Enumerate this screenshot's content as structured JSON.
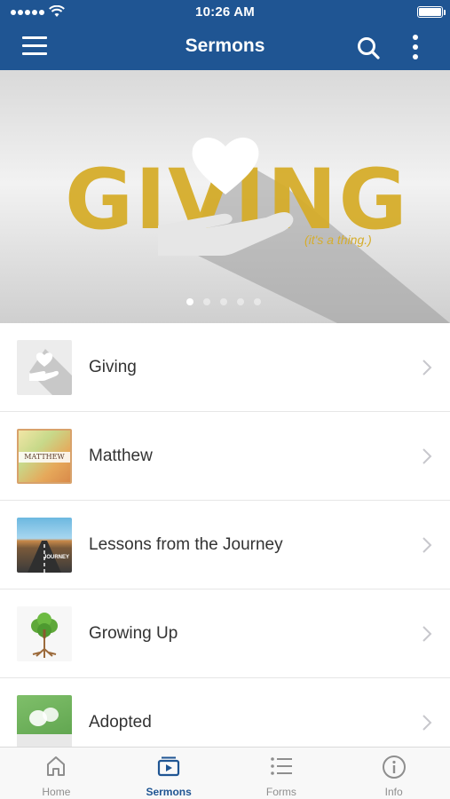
{
  "status_bar": {
    "time": "10:26 AM"
  },
  "header": {
    "title": "Sermons"
  },
  "banner": {
    "headline": "GIVING",
    "tagline": "(it's a thing.)",
    "slide_count": 5,
    "active_slide": 1
  },
  "sermons": [
    {
      "label": "Giving"
    },
    {
      "label": "Matthew",
      "thumb_text": "MATTHEW"
    },
    {
      "label": "Lessons from the Journey",
      "thumb_text": "JOURNEY"
    },
    {
      "label": "Growing Up"
    },
    {
      "label": "Adopted"
    }
  ],
  "tabs": [
    {
      "label": "Home",
      "icon": "home-icon",
      "active": false
    },
    {
      "label": "Sermons",
      "icon": "sermons-icon",
      "active": true
    },
    {
      "label": "Forms",
      "icon": "list-icon",
      "active": false
    },
    {
      "label": "Info",
      "icon": "info-icon",
      "active": false
    }
  ],
  "colors": {
    "primary": "#1f5593",
    "gold": "#d6ad2b",
    "inactive": "#8e8e8e"
  }
}
